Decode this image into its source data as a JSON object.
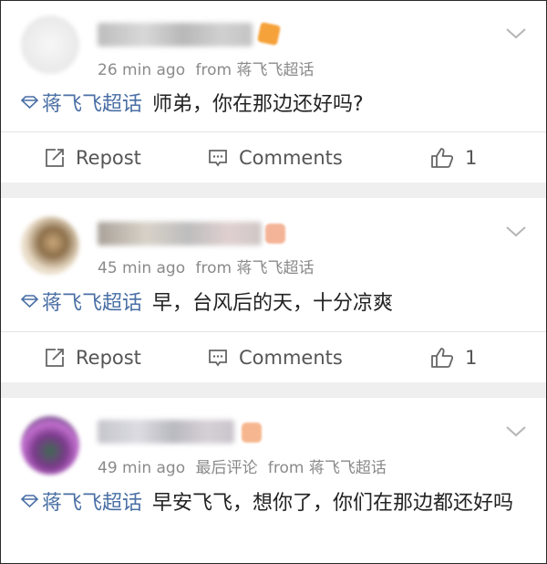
{
  "posts": [
    {
      "time": "26 min ago",
      "source": "蒋飞飞超话",
      "extra": "",
      "topic": "蒋飞飞超话",
      "text": "师弟，你在那边还好吗?",
      "actions": {
        "repost": "Repost",
        "comments": "Comments",
        "likes": "1"
      }
    },
    {
      "time": "45 min ago",
      "source": "蒋飞飞超话",
      "extra": "",
      "topic": "蒋飞飞超话",
      "text": "早，台风后的天，十分凉爽",
      "actions": {
        "repost": "Repost",
        "comments": "Comments",
        "likes": "1"
      }
    },
    {
      "time": "49 min ago",
      "source": "蒋飞飞超话",
      "extra": "最后评论",
      "topic": "蒋飞飞超话",
      "text": "早安飞飞，想你了，你们在那边都还好吗"
    }
  ],
  "labels": {
    "from": "from"
  },
  "colors": {
    "topic": "#4a6fa5",
    "meta": "#8a8a8a",
    "separator": "#efefef"
  },
  "icons": {
    "topic": "super-topic-diamond-icon",
    "repost": "repost-icon",
    "comments": "comment-icon",
    "like": "thumbs-up-icon",
    "more": "chevron-down-icon"
  }
}
